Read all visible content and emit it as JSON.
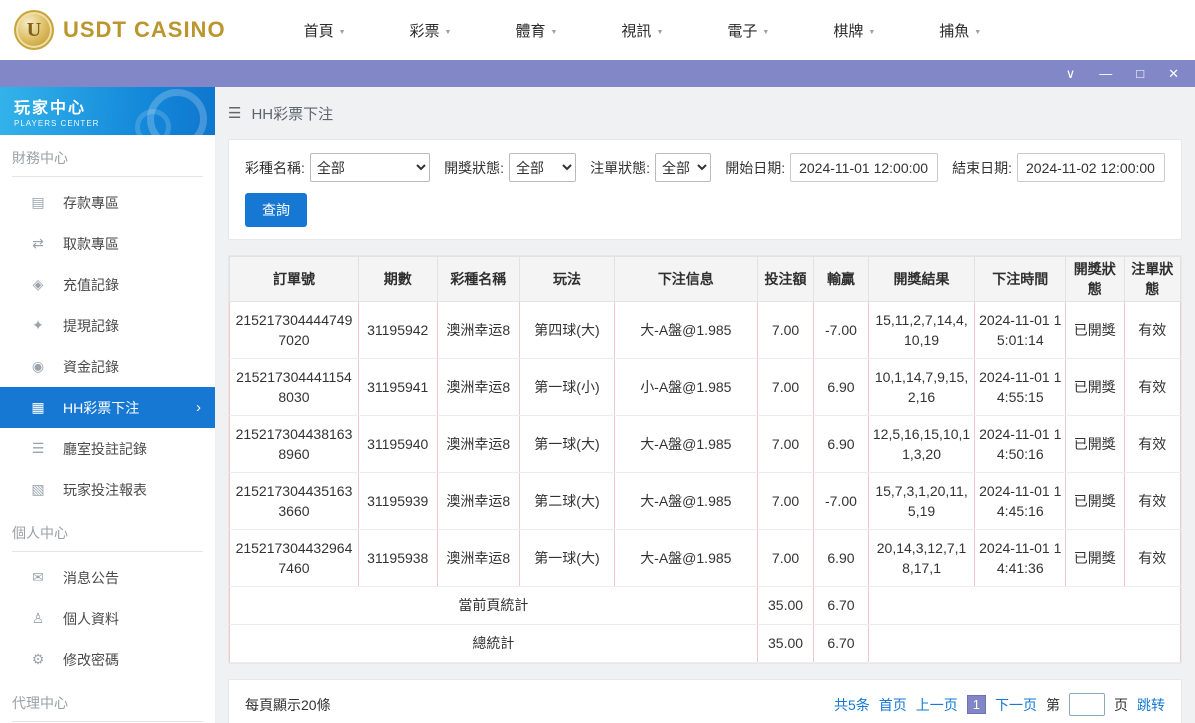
{
  "brand": {
    "logo_letter": "U",
    "logo_text": "USDT CASINO"
  },
  "top_nav": {
    "caret": "▼",
    "items": [
      {
        "label": "首頁"
      },
      {
        "label": "彩票"
      },
      {
        "label": "體育"
      },
      {
        "label": "視訊"
      },
      {
        "label": "電子"
      },
      {
        "label": "棋牌"
      },
      {
        "label": "捕魚"
      }
    ]
  },
  "window_controls": {
    "collapse": "∨",
    "minimize": "—",
    "maximize": "□",
    "close": "✕"
  },
  "sidebar": {
    "header": {
      "title": "玩家中心",
      "subtitle": "PLAYERS CENTER"
    },
    "active_chevron": "›",
    "sections": [
      {
        "label": "財務中心",
        "items": [
          {
            "label": "存款專區",
            "glyph": "▤"
          },
          {
            "label": "取款專區",
            "glyph": "⇄"
          },
          {
            "label": "充值記錄",
            "glyph": "◈"
          },
          {
            "label": "提現記錄",
            "glyph": "✦"
          },
          {
            "label": "資金記錄",
            "glyph": "◉"
          },
          {
            "label": "HH彩票下注",
            "glyph": "▦"
          },
          {
            "label": "廳室投註記錄",
            "glyph": "☰"
          },
          {
            "label": "玩家投注報表",
            "glyph": "▧"
          }
        ]
      },
      {
        "label": "個人中心",
        "items": [
          {
            "label": "消息公告",
            "glyph": "✉"
          },
          {
            "label": "個人資料",
            "glyph": "♙"
          },
          {
            "label": "修改密碼",
            "glyph": "⚙"
          }
        ]
      },
      {
        "label": "代理中心",
        "items": []
      }
    ]
  },
  "breadcrumb": {
    "menu_glyph": "☰",
    "title": "HH彩票下注"
  },
  "filters": {
    "lottery_name_label": "彩種名稱:",
    "lottery_name_value": "全部",
    "draw_status_label": "開獎狀態:",
    "draw_status_value": "全部",
    "order_status_label": "注單狀態:",
    "order_status_value": "全部",
    "start_date_label": "開始日期:",
    "start_date_value": "2024-11-01 12:00:00",
    "end_date_label": "結束日期:",
    "end_date_value": "2024-11-02 12:00:00",
    "search_button": "查詢"
  },
  "table": {
    "headers": [
      "訂單號",
      "期數",
      "彩種名稱",
      "玩法",
      "下注信息",
      "投注額",
      "輸贏",
      "開獎結果",
      "下注時間",
      "開獎狀態",
      "注單狀態"
    ],
    "rows": [
      {
        "order_id": "2152173044447497020",
        "period": "31195942",
        "lottery": "澳洲幸运8",
        "play": "第四球(大)",
        "bet_info": "大-A盤@1.985",
        "amount": "7.00",
        "win_loss": "-7.00",
        "result": "15,11,2,7,14,4,10,19",
        "bet_time": "2024-11-01 15:01:14",
        "draw_status": "已開獎",
        "order_status": "有效"
      },
      {
        "order_id": "2152173044411548030",
        "period": "31195941",
        "lottery": "澳洲幸运8",
        "play": "第一球(小)",
        "bet_info": "小-A盤@1.985",
        "amount": "7.00",
        "win_loss": "6.90",
        "result": "10,1,14,7,9,15,2,16",
        "bet_time": "2024-11-01 14:55:15",
        "draw_status": "已開獎",
        "order_status": "有效"
      },
      {
        "order_id": "2152173044381638960",
        "period": "31195940",
        "lottery": "澳洲幸运8",
        "play": "第一球(大)",
        "bet_info": "大-A盤@1.985",
        "amount": "7.00",
        "win_loss": "6.90",
        "result": "12,5,16,15,10,11,3,20",
        "bet_time": "2024-11-01 14:50:16",
        "draw_status": "已開獎",
        "order_status": "有效"
      },
      {
        "order_id": "2152173044351633660",
        "period": "31195939",
        "lottery": "澳洲幸运8",
        "play": "第二球(大)",
        "bet_info": "大-A盤@1.985",
        "amount": "7.00",
        "win_loss": "-7.00",
        "result": "15,7,3,1,20,11,5,19",
        "bet_time": "2024-11-01 14:45:16",
        "draw_status": "已開獎",
        "order_status": "有效"
      },
      {
        "order_id": "2152173044329647460",
        "period": "31195938",
        "lottery": "澳洲幸运8",
        "play": "第一球(大)",
        "bet_info": "大-A盤@1.985",
        "amount": "7.00",
        "win_loss": "6.90",
        "result": "20,14,3,12,7,18,17,1",
        "bet_time": "2024-11-01 14:41:36",
        "draw_status": "已開獎",
        "order_status": "有效"
      }
    ],
    "summary": [
      {
        "label": "當前頁統計",
        "amount": "35.00",
        "win_loss": "6.70"
      },
      {
        "label": "總統計",
        "amount": "35.00",
        "win_loss": "6.70"
      }
    ]
  },
  "pagination": {
    "page_size_text": "每頁顯示20條",
    "total_text": "共5条",
    "first": "首页",
    "prev": "上一页",
    "current_page": "1",
    "next": "下一页",
    "jump_prefix": "第",
    "jump_suffix": "页",
    "jump_button": "跳转"
  }
}
